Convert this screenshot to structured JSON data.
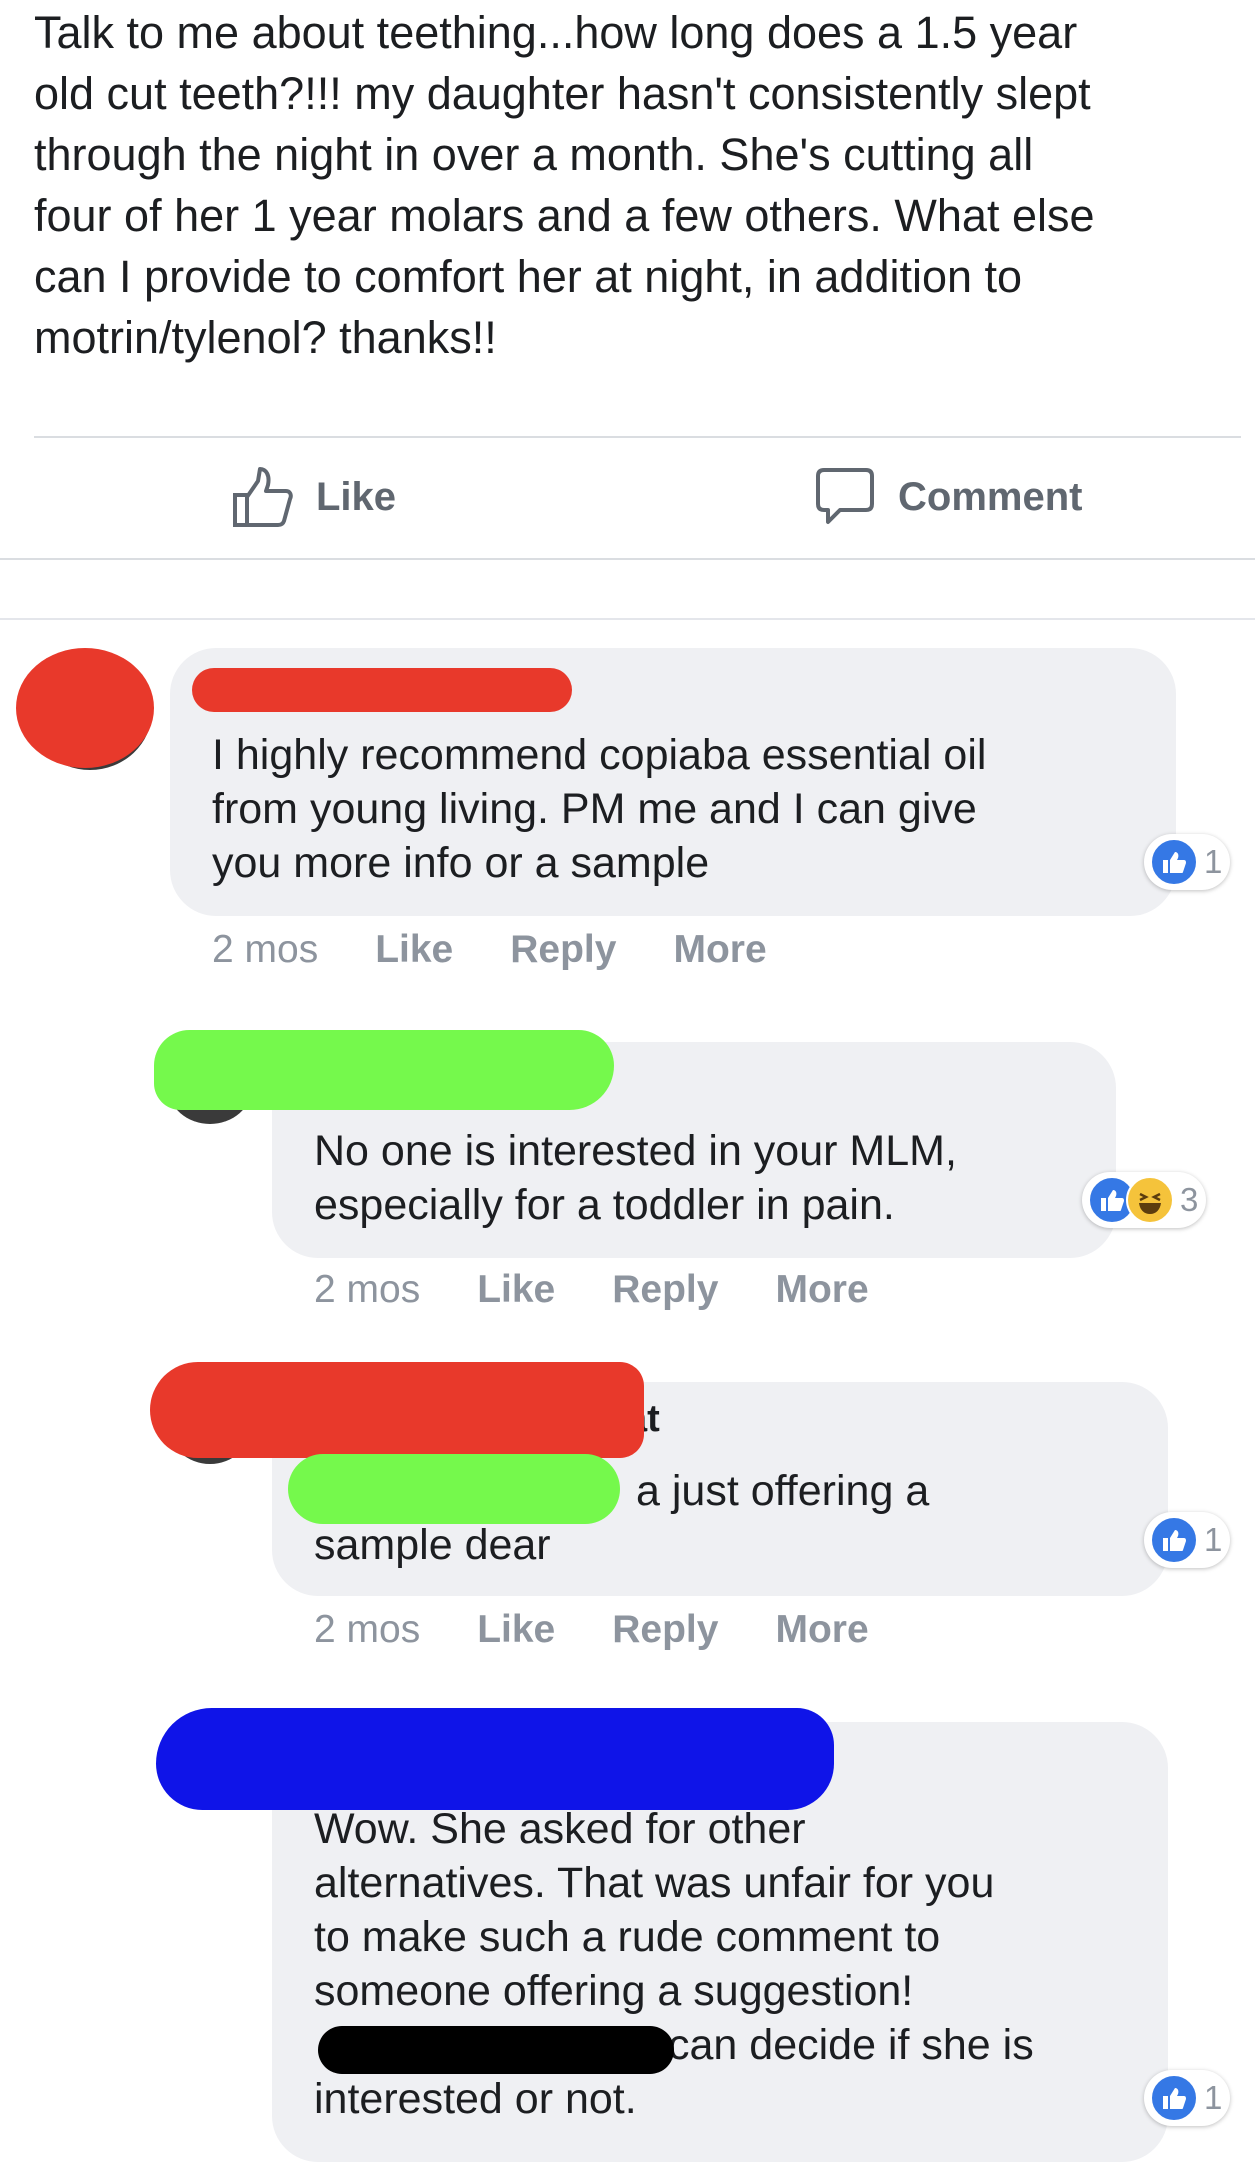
{
  "post": {
    "text_lines": [
      "Talk to me about teething...how long does a 1.5 year",
      "old cut teeth?!!! my daughter hasn't consistently slept",
      "through the night in over a month. She's cutting all",
      "four of her 1 year molars and a few others. What else",
      "can I provide to comfort her at night, in addition to",
      "motrin/tylenol? thanks!!"
    ],
    "like_label": "Like",
    "comment_label": "Comment"
  },
  "comments": [
    {
      "text_lines": [
        "I highly recommend copiaba essential oil",
        "from young living. PM me and I can give",
        "you more info or a sample"
      ],
      "reaction_count": "1",
      "time": "2 mos",
      "like": "Like",
      "reply": "Reply",
      "more": "More",
      "redaction_color": "#e8392b"
    },
    {
      "text_lines": [
        "No one is interested in your MLM,",
        "especially for a toddler in pain."
      ],
      "reaction_count": "3",
      "time": "2 mos",
      "like": "Like",
      "reply": "Reply",
      "more": "More",
      "redaction_color": "#75f94c"
    },
    {
      "text_lines": [
        "a just offering a",
        "sample dear"
      ],
      "name_fragment": "at",
      "reaction_count": "1",
      "time": "2 mos",
      "like": "Like",
      "reply": "Reply",
      "more": "More",
      "redaction_colors": [
        "#e8392b",
        "#75f94c"
      ]
    },
    {
      "text_lines": [
        "Wow. She asked for other",
        "alternatives. That was unfair for you",
        "to make such a rude comment to",
        "someone offering a suggestion!",
        "can decide if she is",
        "interested or not."
      ],
      "reaction_count": "1",
      "redaction_colors": [
        "#0f14e8",
        "#000000"
      ]
    }
  ],
  "colors": {
    "bubble": "#eff0f3",
    "meta_text": "#8d949e",
    "like_blue": "#3578e5",
    "divider": "#dadde1"
  },
  "icons": [
    "thumbs-up-outline-icon",
    "comment-bubble-icon",
    "like-reaction-icon",
    "haha-reaction-icon"
  ]
}
